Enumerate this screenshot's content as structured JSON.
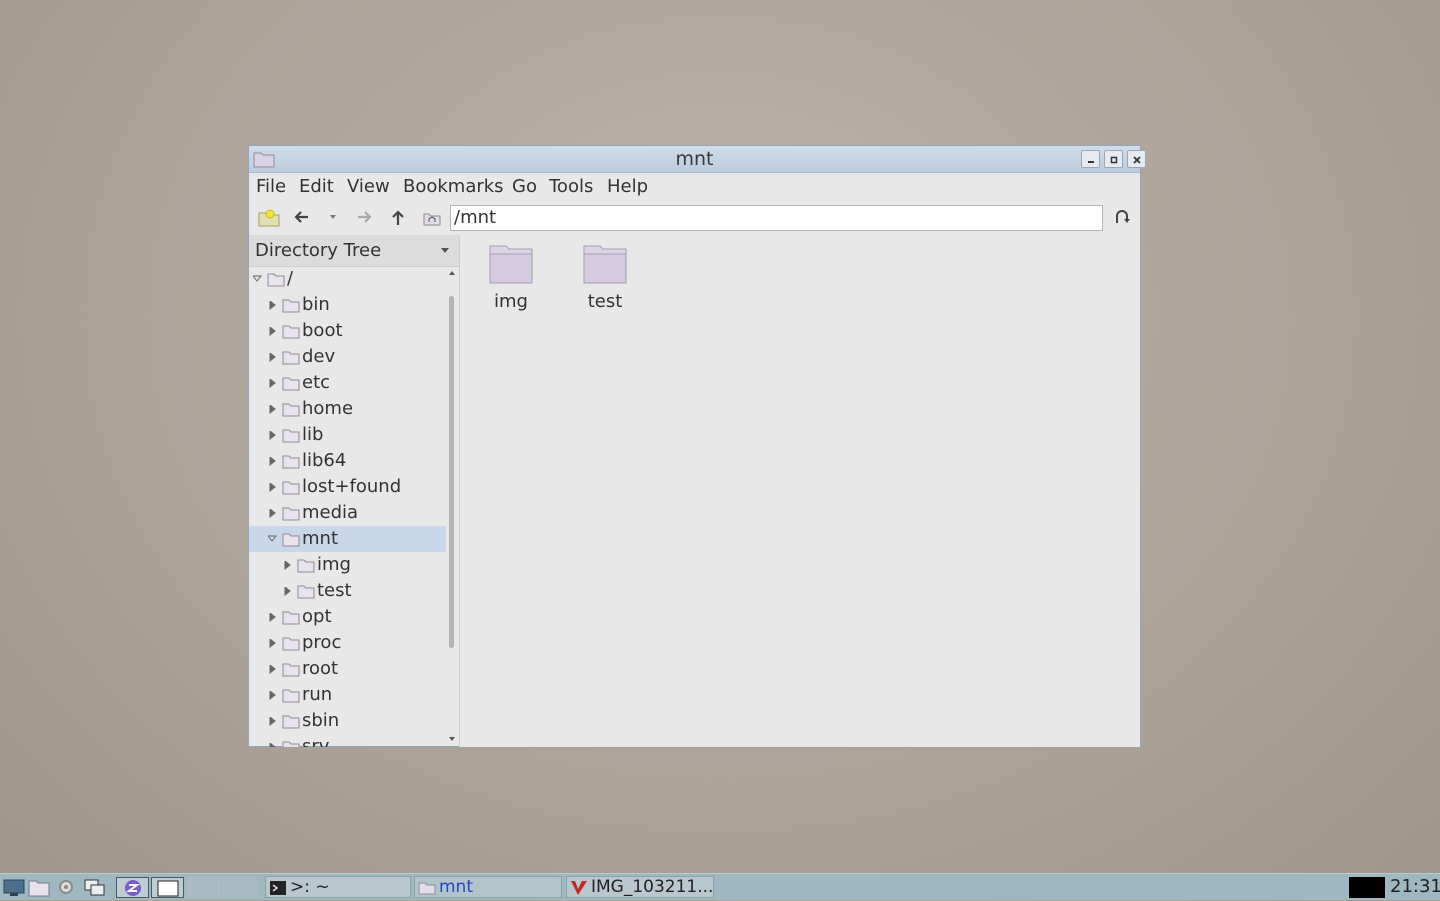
{
  "window": {
    "title": "mnt",
    "minimize_icon": "minimize-icon",
    "maximize_icon": "maximize-icon",
    "close_icon": "close-icon"
  },
  "menu": [
    "File",
    "Edit",
    "View",
    "Bookmarks",
    "Go",
    "Tools",
    "Help"
  ],
  "toolbar": {
    "location": "/mnt",
    "buttons": [
      "new-tab-icon",
      "back-icon",
      "history-dropdown-icon",
      "forward-icon",
      "up-icon",
      "home-icon",
      "reload-icon"
    ]
  },
  "sidebar": {
    "header": "Directory Tree",
    "tree": [
      {
        "label": "/",
        "depth": 0,
        "expanded": true
      },
      {
        "label": "bin",
        "depth": 1
      },
      {
        "label": "boot",
        "depth": 1
      },
      {
        "label": "dev",
        "depth": 1
      },
      {
        "label": "etc",
        "depth": 1
      },
      {
        "label": "home",
        "depth": 1
      },
      {
        "label": "lib",
        "depth": 1
      },
      {
        "label": "lib64",
        "depth": 1
      },
      {
        "label": "lost+found",
        "depth": 1
      },
      {
        "label": "media",
        "depth": 1
      },
      {
        "label": "mnt",
        "depth": 1,
        "expanded": true,
        "selected": true
      },
      {
        "label": "img",
        "depth": 2
      },
      {
        "label": "test",
        "depth": 2
      },
      {
        "label": "opt",
        "depth": 1
      },
      {
        "label": "proc",
        "depth": 1
      },
      {
        "label": "root",
        "depth": 1
      },
      {
        "label": "run",
        "depth": 1
      },
      {
        "label": "sbin",
        "depth": 1
      },
      {
        "label": "srv",
        "depth": 1
      }
    ]
  },
  "files": [
    {
      "name": "img",
      "icon": "folder-icon"
    },
    {
      "name": "test",
      "icon": "folder-icon"
    }
  ],
  "taskbar": {
    "launchers": [
      "show-desktop-icon",
      "file-manager-icon",
      "settings-icon",
      "window-list-icon",
      "app-icon",
      "blank-window-icon"
    ],
    "tasks": [
      {
        "label": ">: ~",
        "icon": "terminal-icon"
      },
      {
        "label": "mnt",
        "icon": "folder-icon"
      },
      {
        "label": "IMG_103211...",
        "icon": "image-viewer-icon"
      }
    ],
    "clock": "21:31"
  },
  "colors": {
    "selection": "#c8d7e9",
    "titlebar": "#c5d4e5",
    "taskbar": "#9db8c1",
    "folder": "#d8cfe0"
  }
}
